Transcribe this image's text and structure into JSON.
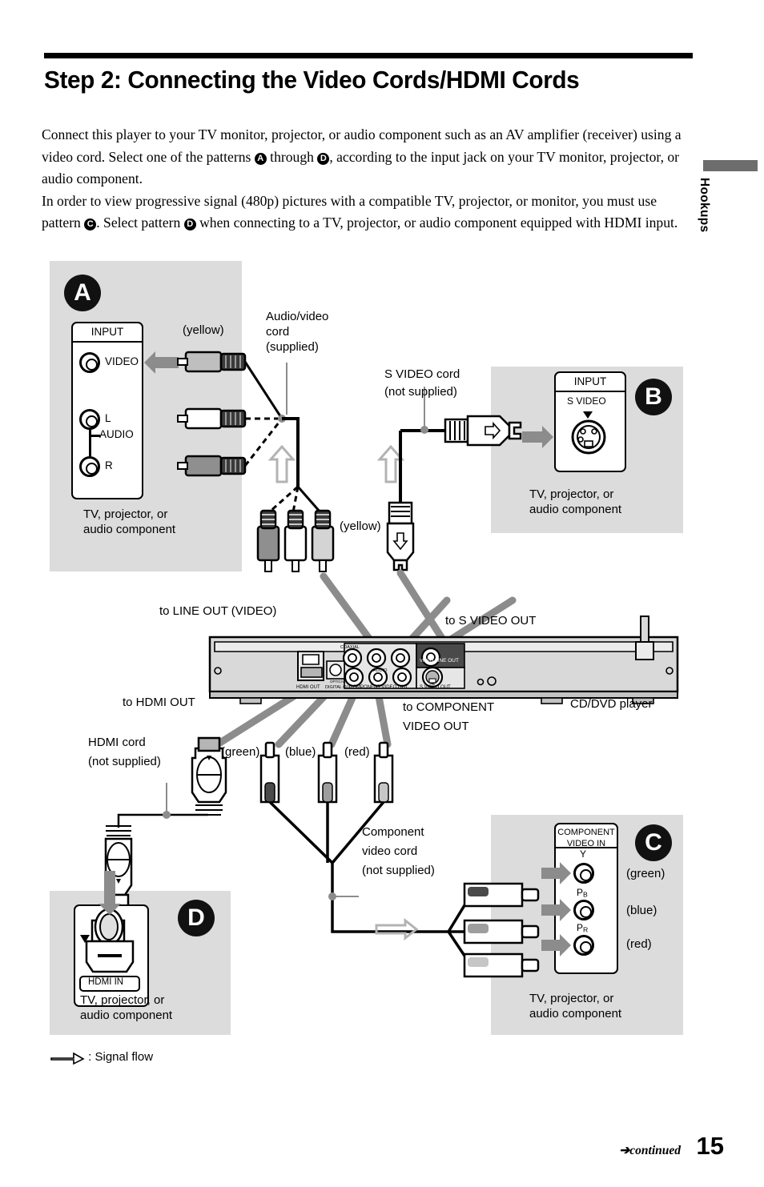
{
  "header": {
    "title": "Step 2: Connecting the Video Cords/HDMI Cords",
    "side_tab": "Hookups"
  },
  "intro": {
    "line1_a": "Connect this player to your TV monitor, projector, or audio component such as an AV amplifier (receiver) using a video cord. Select one of the patterns ",
    "badge_a": "A",
    "line1_b": " through ",
    "badge_d": "D",
    "line1_c": ", according to the input jack on your TV monitor, projector, or audio component.",
    "line2_a": "In order to view progressive signal (480p) pictures with a compatible TV, projector, or monitor, you must use pattern ",
    "badge_c": "C",
    "line2_b": ". Select pattern ",
    "badge_d2": "D",
    "line2_c": " when connecting to a TV, projector, or audio component equipped with HDMI input."
  },
  "panels": {
    "a": {
      "badge": "A",
      "box_header": "INPUT",
      "jacks": [
        "VIDEO",
        "L",
        "R"
      ],
      "audio_label": "AUDIO",
      "device": "TV, projector, or\naudio component",
      "device_line1": "TV, projector, or",
      "device_line2": "audio component"
    },
    "b": {
      "badge": "B",
      "box_header": "INPUT",
      "jack_label": "S VIDEO",
      "cord_line1": "S VIDEO cord",
      "cord_line2": "(not supplied)",
      "device_line1": "TV, projector, or",
      "device_line2": "audio component"
    },
    "c": {
      "badge": "C",
      "box_header_line1": "COMPONENT",
      "box_header_line2": "VIDEO IN",
      "jacks": [
        {
          "label": "Y",
          "color": "(green)"
        },
        {
          "label": "PB",
          "color": "(blue)"
        },
        {
          "label": "PR",
          "color": "(red)"
        }
      ],
      "cord_line1": "Component",
      "cord_line2": "video cord",
      "cord_line3": "(not supplied)",
      "device_line1": "TV, projector, or",
      "device_line2": "audio component"
    },
    "d": {
      "badge": "D",
      "jack_label": "HDMI IN",
      "cord_line1": "HDMI cord",
      "cord_line2": "(not supplied)",
      "device_line1": "TV, projector, or",
      "device_line2": "audio component"
    }
  },
  "cords": {
    "av_line1": "Audio/video",
    "av_line2": "cord",
    "av_line3": "(supplied)",
    "yellow_top": "(yellow)",
    "yellow_bottom": "(yellow)",
    "component_colors": [
      "(green)",
      "(blue)",
      "(red)"
    ]
  },
  "player": {
    "name": "CD/DVD player",
    "rear_labels": {
      "hdmi": "HDMI OUT",
      "digital": "DIGITAL OUT",
      "optical": "OPTICAL",
      "component": "COMPONENT VIDEO OUT",
      "svideo": "S VIDEO OUT",
      "line": "LINE OUT",
      "coaxial": "COAXIAL",
      "audio": "AUDIO",
      "video": "VIDEO"
    }
  },
  "callouts": {
    "line_out_video": "to LINE OUT (VIDEO)",
    "s_video_out": "to S VIDEO OUT",
    "hdmi_out": "to HDMI OUT",
    "component_video_out_line1": "to COMPONENT",
    "component_video_out_line2": "VIDEO OUT"
  },
  "legend": ": Signal flow",
  "footer": {
    "continued": "continued",
    "page_number": "15"
  },
  "colors": {
    "gray_panel": "#dcdcdc",
    "arrow_gray": "#8c8c8c",
    "black": "#000000",
    "tab_gray": "#6d6d6d"
  }
}
